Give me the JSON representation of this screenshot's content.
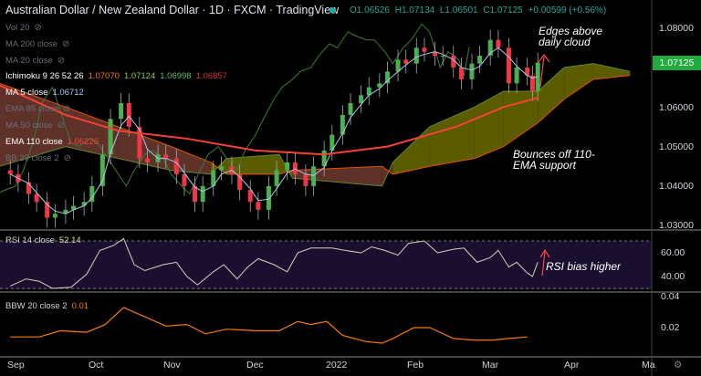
{
  "header": {
    "title": "Australian Dollar / New Zealand Dollar · 1D · FXCM · TradingView",
    "open": "O1.06526",
    "high": "H1.07134",
    "low": "L1.06501",
    "close": "C1.07125",
    "change": "+0.00599 (+0.56%)"
  },
  "legend": {
    "vol": "Vol 20",
    "ma200": "MA 200 close",
    "ma20": "MA 20 close",
    "ichimoku": "Ichimoku 9 26 52 26",
    "ichi_v1": "1.07070",
    "ichi_v2": "1.07124",
    "ichi_v3": "1.06998",
    "ichi_v4": "1.06857",
    "ma5": "MA 5 close",
    "ma5_v": "1.06712",
    "ema85": "EMA 85 close",
    "ma50": "MA 50 close",
    "ema110": "EMA 110 close",
    "ema110_v": "1.06226",
    "bb": "BB 20 close 2",
    "rsi": "RSI 14 close",
    "rsi_v": "52.14",
    "bbw": "BBW 20 close 2",
    "bbw_v": "0.01"
  },
  "annotations": {
    "a1": "Edges above daily cloud",
    "a2": "Bounces off 110-EMA support",
    "a3": "RSI bias higher"
  },
  "colors": {
    "up": "#26a69a",
    "candle_up": "#4caf50",
    "candle_down": "#f23645",
    "ema110": "#f44336",
    "ma5": "#a8c8e8",
    "bull_cloud": "#6b6b00",
    "bear_cloud": "#6e3a30",
    "rsi": "#d8d0c0",
    "bbw": "#f57c00",
    "chikou": "#3d7a3d",
    "rsi_bg": "#1a0f2e"
  },
  "chart_data": [
    {
      "type": "candlestick",
      "title": "Australian Dollar / New Zealand Dollar · 1D · FXCM",
      "yticks": [
        "1.08000",
        "1.07000",
        "1.06000",
        "1.05000",
        "1.04000",
        "1.03000"
      ],
      "ylim": [
        1.029,
        1.085
      ],
      "last_price": "1.07125",
      "xticks": [
        "Sep",
        "Oct",
        "Nov",
        "Dec",
        "2022",
        "Feb",
        "Mar",
        "Apr",
        "Ma"
      ],
      "dates": [
        "2021-08-30",
        "2021-09-02",
        "2021-09-06",
        "2021-09-09",
        "2021-09-13",
        "2021-09-16",
        "2021-09-20",
        "2021-09-23",
        "2021-09-27",
        "2021-09-30",
        "2021-10-04",
        "2021-10-07",
        "2021-10-11",
        "2021-10-14",
        "2021-10-18",
        "2021-10-21",
        "2021-10-25",
        "2021-10-28",
        "2021-11-01",
        "2021-11-04",
        "2021-11-08",
        "2021-11-11",
        "2021-11-15",
        "2021-11-18",
        "2021-11-22",
        "2021-11-25",
        "2021-11-29",
        "2021-12-02",
        "2021-12-06",
        "2021-12-09",
        "2021-12-13",
        "2021-12-16",
        "2021-12-20",
        "2021-12-23",
        "2021-12-27",
        "2021-12-30",
        "2022-01-03",
        "2022-01-06",
        "2022-01-10",
        "2022-01-13",
        "2022-01-17",
        "2022-01-20",
        "2022-01-24",
        "2022-01-27",
        "2022-01-31",
        "2022-02-03",
        "2022-02-07",
        "2022-02-10",
        "2022-02-14",
        "2022-02-17",
        "2022-02-21",
        "2022-02-24",
        "2022-02-28",
        "2022-03-03",
        "2022-03-07",
        "2022-03-10",
        "2022-03-14",
        "2022-03-16",
        "2022-03-18"
      ],
      "close": [
        1.043,
        1.041,
        1.038,
        1.036,
        1.032,
        1.033,
        1.034,
        1.035,
        1.036,
        1.04,
        1.048,
        1.057,
        1.061,
        1.055,
        1.047,
        1.046,
        1.048,
        1.047,
        1.043,
        1.04,
        1.036,
        1.04,
        1.044,
        1.045,
        1.043,
        1.039,
        1.036,
        1.034,
        1.04,
        1.044,
        1.046,
        1.043,
        1.04,
        1.045,
        1.049,
        1.053,
        1.058,
        1.061,
        1.063,
        1.065,
        1.066,
        1.069,
        1.072,
        1.071,
        1.075,
        1.074,
        1.073,
        1.073,
        1.07,
        1.067,
        1.071,
        1.073,
        1.077,
        1.075,
        1.066,
        1.07,
        1.068,
        1.064,
        1.07125
      ]
    },
    {
      "type": "line",
      "name": "EMA 110 close",
      "dates": [
        "2021-08-26",
        "2021-09-20",
        "2021-10-10",
        "2021-11-05",
        "2021-12-01",
        "2021-12-27",
        "2022-01-20",
        "2022-02-15",
        "2022-03-05",
        "2022-03-18"
      ],
      "values": [
        1.0655,
        1.058,
        1.054,
        1.052,
        1.049,
        1.048,
        1.05,
        1.055,
        1.06,
        1.0623
      ]
    },
    {
      "type": "area",
      "name": "Ichimoku cloud",
      "dates": [
        "2021-08-26",
        "2021-09-20",
        "2021-10-10",
        "2021-10-30",
        "2021-11-14",
        "2021-11-20",
        "2021-12-10",
        "2021-12-15",
        "2022-01-18",
        "2022-01-22",
        "2022-02-05",
        "2022-02-22",
        "2022-03-05",
        "2022-03-18",
        "2022-03-28",
        "2022-04-08",
        "2022-04-22"
      ],
      "span_a": [
        1.045,
        1.05,
        1.047,
        1.044,
        1.043,
        1.047,
        1.048,
        1.042,
        1.04,
        1.046,
        1.055,
        1.06,
        1.064,
        1.064,
        1.07,
        1.071,
        1.069
      ],
      "span_b": [
        1.066,
        1.06,
        1.055,
        1.05,
        1.046,
        1.043,
        1.043,
        1.044,
        1.045,
        1.043,
        1.045,
        1.047,
        1.05,
        1.056,
        1.062,
        1.067,
        1.068
      ]
    },
    {
      "type": "line",
      "name": "RSI 14 close",
      "yticks": [
        "60.00",
        "40.00"
      ],
      "ylim": [
        28,
        75
      ],
      "bands": [
        30,
        70
      ],
      "dates": [
        "2021-08-30",
        "2021-09-05",
        "2021-09-10",
        "2021-09-15",
        "2021-09-22",
        "2021-09-28",
        "2021-10-03",
        "2021-10-08",
        "2021-10-12",
        "2021-10-16",
        "2021-10-20",
        "2021-10-27",
        "2021-11-01",
        "2021-11-05",
        "2021-11-09",
        "2021-11-15",
        "2021-11-19",
        "2021-11-24",
        "2021-11-28",
        "2021-12-02",
        "2021-12-08",
        "2021-12-13",
        "2021-12-17",
        "2021-12-22",
        "2021-12-30",
        "2022-01-04",
        "2022-01-10",
        "2022-01-14",
        "2022-01-19",
        "2022-01-24",
        "2022-01-28",
        "2022-02-03",
        "2022-02-08",
        "2022-02-14",
        "2022-02-18",
        "2022-02-23",
        "2022-02-28",
        "2022-03-03",
        "2022-03-07",
        "2022-03-10",
        "2022-03-14",
        "2022-03-16",
        "2022-03-18"
      ],
      "values": [
        32,
        38,
        36,
        30,
        31,
        42,
        62,
        66,
        72,
        50,
        45,
        50,
        52,
        40,
        33,
        44,
        50,
        38,
        48,
        55,
        50,
        44,
        60,
        64,
        64,
        62,
        60,
        65,
        62,
        58,
        68,
        70,
        60,
        63,
        64,
        52,
        56,
        62,
        48,
        52,
        43,
        40,
        52.14
      ]
    },
    {
      "type": "line",
      "name": "BBW 20 close 2",
      "yticks": [
        "0.04",
        "0.02"
      ],
      "dates": [
        "2021-08-30",
        "2021-09-10",
        "2021-09-18",
        "2021-09-28",
        "2021-10-05",
        "2021-10-12",
        "2021-10-20",
        "2021-10-28",
        "2021-11-05",
        "2021-11-12",
        "2021-11-20",
        "2021-12-01",
        "2021-12-10",
        "2021-12-17",
        "2021-12-22",
        "2021-12-28",
        "2022-01-03",
        "2022-01-12",
        "2022-01-18",
        "2022-01-22",
        "2022-01-30",
        "2022-02-05",
        "2022-02-14",
        "2022-02-22",
        "2022-03-01",
        "2022-03-07",
        "2022-03-14"
      ],
      "values": [
        0.014,
        0.014,
        0.018,
        0.017,
        0.022,
        0.033,
        0.027,
        0.021,
        0.022,
        0.016,
        0.019,
        0.018,
        0.018,
        0.024,
        0.022,
        0.024,
        0.015,
        0.011,
        0.01,
        0.013,
        0.02,
        0.02,
        0.013,
        0.012,
        0.012,
        0.013,
        0.014
      ]
    }
  ]
}
